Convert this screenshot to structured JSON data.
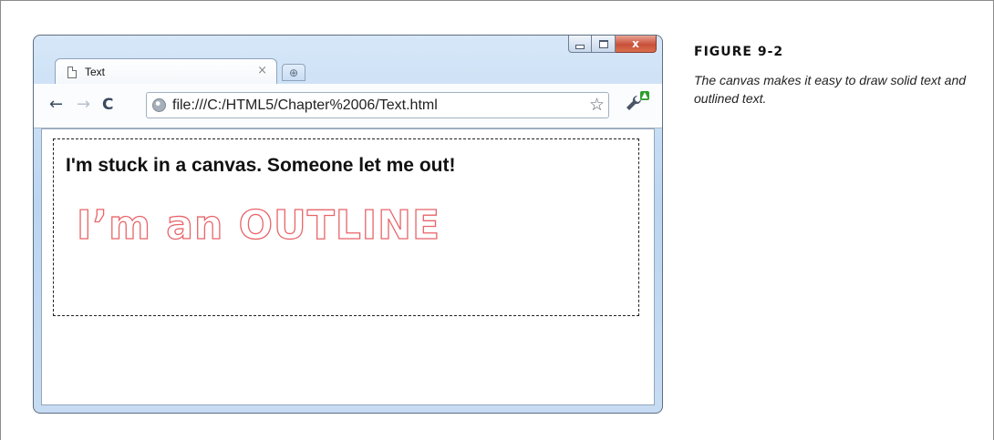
{
  "browser": {
    "tab": {
      "title": "Text",
      "close_glyph": "×",
      "icon": "page-icon"
    },
    "new_tab_glyph": "⊕",
    "window_controls": {
      "minimize": "minimize-icon",
      "maximize": "maximize-icon",
      "close_glyph": "x"
    },
    "toolbar": {
      "back_glyph": "←",
      "forward_glyph": "→",
      "reload_glyph": "C",
      "address": "file:///C:/HTML5/Chapter%2006/Text.html",
      "star_glyph": "☆",
      "wrench_glyph": "🔧"
    }
  },
  "canvas": {
    "solid_text": "I'm stuck in a canvas. Someone let me out!",
    "outline_text": "I’m an OUTLINE",
    "outline_color": "#e8656a"
  },
  "figure": {
    "label": "FIGURE 9-2",
    "caption": "The canvas makes it easy to draw solid text and outlined text."
  }
}
